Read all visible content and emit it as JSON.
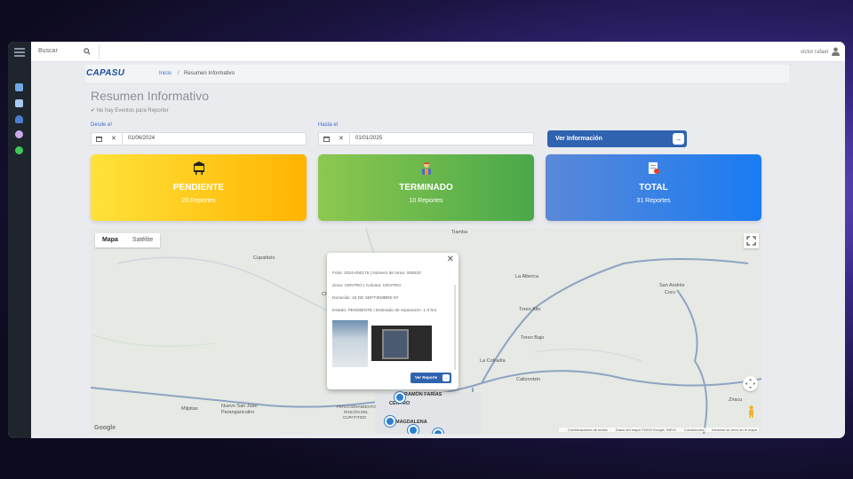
{
  "topbar": {
    "search_label": "Buscar",
    "user_name": "victor rafael"
  },
  "breadcrumb": {
    "logo": "CAPASU",
    "home": "Inicio",
    "separator": "/",
    "current": "Resumen Informativo"
  },
  "page": {
    "title": "Resumen Informativo",
    "no_events": "✔ No hay Eventos para Reporter"
  },
  "filters": {
    "from_label": "Desde el",
    "from_value": "01/06/2024",
    "to_label": "Hasta el",
    "to_value": "01/01/2025",
    "button_label": "Ver Información",
    "button_arrow": "→"
  },
  "cards": {
    "pending": {
      "title": "PENDIENTE",
      "count": "20 Reportes",
      "color": "#ffc400"
    },
    "done": {
      "title": "TERMINADO",
      "count": "10 Reportes",
      "color": "#6ab84e"
    },
    "total": {
      "title": "TOTAL",
      "count": "31 Reportes",
      "color": "#2f80ed"
    }
  },
  "map": {
    "tab_map": "Mapa",
    "tab_satellite": "Satélite",
    "labels": [
      "Tiamba",
      "Cupatitzio",
      "La Alberca",
      "San Andrés",
      "Coru",
      "Toreo Alto",
      "Toreo Bajo",
      "La Cofradía",
      "Caltzontzin",
      "Ziracu",
      "Milpitas",
      "Nuevo San Juan",
      "Parangaricutiro",
      "CENTRO",
      "RAMÓN FARÍAS",
      "MAGDALENA",
      "FRACCIONAMIENTO",
      "RINCÓN DEL",
      "CUPATITZIO",
      "Che"
    ],
    "google": "Google",
    "footer": [
      "Combinaciones de teclas",
      "Datos del mapa ©2025 Google, INEGI",
      "Condiciones",
      "Informar un error en el mapa"
    ]
  },
  "popup": {
    "close": "✕",
    "line1": "Folio: 2024-000175 | Número de toma: 005020",
    "line2": "Zona: CENTRO | Colonia: CENTRO",
    "line3": "Domicilio: 16 DE SEPTIEMBRE 87",
    "line4": "Estado: PENDIENTE | Estimado de reparación: 1-3 hrs",
    "button_label": "Ver Reporte",
    "button_arrow": "→"
  }
}
